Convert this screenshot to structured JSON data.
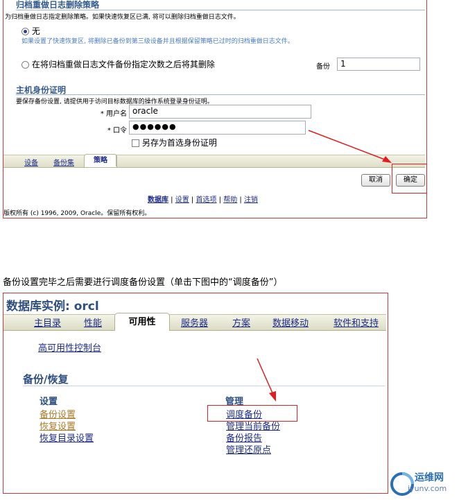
{
  "panel1": {
    "archive_title": "归档重做日志删除策略",
    "archive_desc": "为归档重做日志指定删除策略。如果快速恢复区已满, 将可以删除归档重做日志文件。",
    "option_none": "无",
    "option_none_note": "如果设置了快速恢复区, 将删除已备份到第三级设备并且根据保留策略已过时的归档重做日志文件。",
    "option_backup": "在将归档重做日志文件备份指定次数之后将其删除",
    "backups_label": "备份",
    "backups_value": "1",
    "host_title": "主机身份证明",
    "host_desc": "要保存备份设置, 请提供用于访问目标数据库的操作系统登录身份证明。",
    "username_label": "* 用户名",
    "username_value": "oracle",
    "password_label": "* 口令",
    "password_value": "●●●●●●",
    "save_pref": "另存为首选身份证明",
    "tabs": [
      "设备",
      "备份集",
      "策略"
    ],
    "cancel": "取消",
    "ok": "确定",
    "footer_links": [
      "数据库",
      "设置",
      "首选项",
      "帮助",
      "注销"
    ],
    "copyright": "版权所有 (c) 1996, 2009, Oracle。保留所有权利。"
  },
  "instruction": "备份设置完毕之后需要进行调度备份设置（单击下图中的“调度备份”）",
  "panel2": {
    "title": "数据库实例: orcl",
    "tabs": [
      "主目录",
      "性能",
      "可用性",
      "服务器",
      "方案",
      "数据移动",
      "软件和支持"
    ],
    "ha_console": "高可用性控制台",
    "section": "备份/恢复",
    "setup_title": "设置",
    "setup_links": [
      "备份设置",
      "恢复设置",
      "恢复目录设置"
    ],
    "manage_title": "管理",
    "manage_links": [
      "调度备份",
      "管理当前备份",
      "备份报告",
      "管理还原点"
    ]
  },
  "watermark": {
    "brand": "运维网",
    "url": "iyunv.com"
  }
}
